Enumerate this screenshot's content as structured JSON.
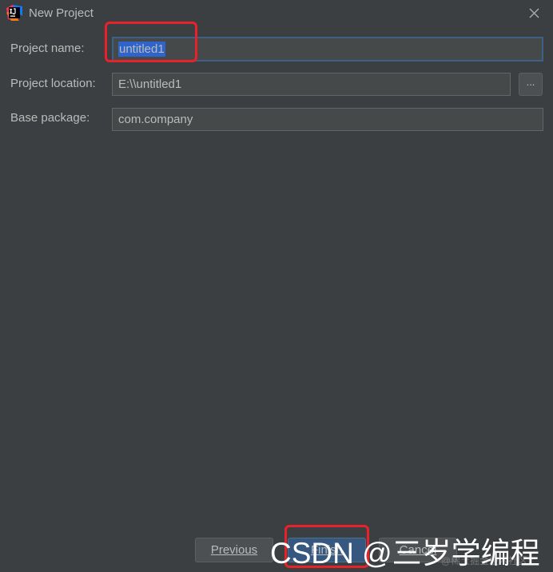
{
  "window": {
    "title": "New Project",
    "app_icon": "intellij-idea-icon",
    "close_icon": "close-icon"
  },
  "form": {
    "project_name": {
      "label": "Project name:",
      "value": "untitled1"
    },
    "project_location": {
      "label": "Project location:",
      "value": "E:\\\\untitled1",
      "browse_label": "..."
    },
    "base_package": {
      "label": "Base package:",
      "value": "com.company"
    }
  },
  "buttons": {
    "previous": "Previous",
    "finish": "Finish",
    "cancel": "Cancel"
  },
  "watermark": {
    "text": "CSDN @三岁学编程",
    "faint_text": "@稀土掘金技术社区"
  },
  "colors": {
    "background": "#3c3f41",
    "input_background": "#45494a",
    "focus_border": "#3d6185",
    "selection": "#2f65ca",
    "primary_button": "#365880",
    "annotation_red": "#e8222b"
  }
}
